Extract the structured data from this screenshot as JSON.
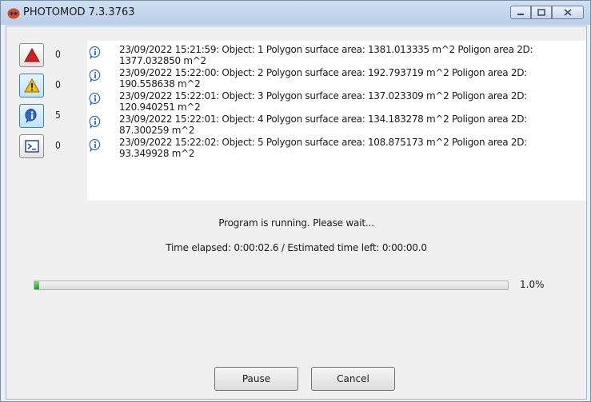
{
  "window": {
    "title": "PHOTOMOD 7.3.3763"
  },
  "filters": [
    {
      "name": "error",
      "count": "0"
    },
    {
      "name": "warning",
      "count": "0"
    },
    {
      "name": "info",
      "count": "5"
    },
    {
      "name": "command",
      "count": "0"
    }
  ],
  "log": [
    {
      "icon": "info-icon",
      "line1": "23/09/2022 15:21:59: Object: 1 Polygon surface area: 1381.013335 m^2 Poligon area 2D:",
      "line2": "1377.032850 m^2"
    },
    {
      "icon": "info-icon",
      "line1": "23/09/2022 15:22:00: Object: 2 Polygon surface area: 192.793719 m^2 Poligon area 2D:",
      "line2": "190.558638 m^2"
    },
    {
      "icon": "info-icon",
      "line1": "23/09/2022 15:22:01: Object: 3 Polygon surface area: 137.023309 m^2 Poligon area 2D:",
      "line2": "120.940251 m^2"
    },
    {
      "icon": "info-icon",
      "line1": "23/09/2022 15:22:01: Object: 4 Polygon surface area: 134.183278 m^2 Poligon area 2D:",
      "line2": "87.300259 m^2"
    },
    {
      "icon": "info-icon",
      "line1": "23/09/2022 15:22:02: Object: 5 Polygon surface area: 108.875173 m^2 Poligon area 2D:",
      "line2": "93.349928 m^2"
    }
  ],
  "status": {
    "message": "Program is running. Please wait...",
    "time": "Time elapsed: 0:00:02.6  /  Estimated time left: 0:00:00.0"
  },
  "progress": {
    "value": 0.01,
    "label": "1.0%"
  },
  "buttons": {
    "pause": "Pause",
    "cancel": "Cancel"
  },
  "colors": {
    "progress_fill": "#1f9a1f",
    "error": "#d42020",
    "warning": "#f2c500",
    "info": "#2b67c8"
  }
}
